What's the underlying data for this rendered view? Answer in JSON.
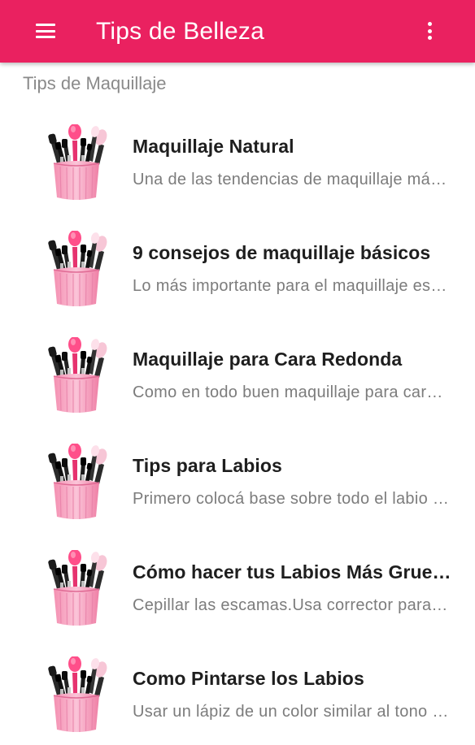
{
  "app_bar": {
    "title": "Tips de Belleza",
    "menu_icon": "hamburger-menu-icon",
    "overflow_icon": "more-vert-icon",
    "color": "#ea2160"
  },
  "section": {
    "header": "Tips de Maquillaje"
  },
  "items": [
    {
      "title": "Maquillaje Natural",
      "description": "Una de las tendencias de maquillaje más populares de esta temporada",
      "icon": "makeup-brushes-icon"
    },
    {
      "title": "9 consejos de maquillaje básicos",
      "description": "Lo más importante para el maquillaje es una buena base",
      "icon": "makeup-brushes-icon"
    },
    {
      "title": "Maquillaje para Cara Redonda",
      "description": "Como en todo buen maquillaje para cara redonda, lo primero",
      "icon": "makeup-brushes-icon"
    },
    {
      "title": "Tips para Labios",
      "description": "Primero colocá base sobre todo el labio y luego polvo",
      "icon": "makeup-brushes-icon"
    },
    {
      "title": "Cómo hacer tus Labios Más Grueso",
      "description": "Cepillar las escamas.Usa corrector para delinear",
      "icon": "makeup-brushes-icon"
    },
    {
      "title": "Como Pintarse los Labios",
      "description": "Usar un lápiz de un color similar al tono del labial",
      "icon": "makeup-brushes-icon"
    }
  ]
}
